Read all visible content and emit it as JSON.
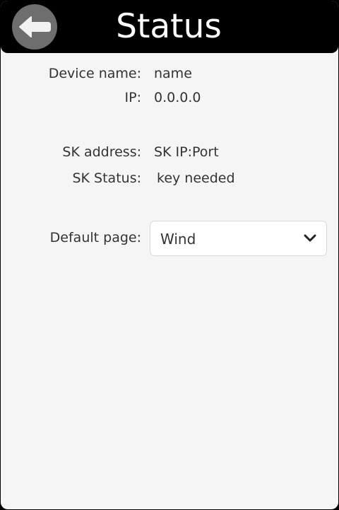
{
  "header": {
    "title": "Status",
    "back_icon": "arrow-left-icon"
  },
  "device": {
    "name_label": "Device name:",
    "name_value": "name",
    "ip_label": "IP:",
    "ip_value": "0.0.0.0"
  },
  "signalk": {
    "address_label": "SK address:",
    "address_value": "SK IP:Port",
    "status_label": "SK Status:",
    "status_value": "key needed"
  },
  "default_page": {
    "label": "Default page:",
    "selected": "Wind",
    "icon": "chevron-down-icon"
  },
  "colors": {
    "header_bg": "#000000",
    "back_button_bg": "#6e6e6e",
    "page_bg": "#f5f5f5"
  }
}
